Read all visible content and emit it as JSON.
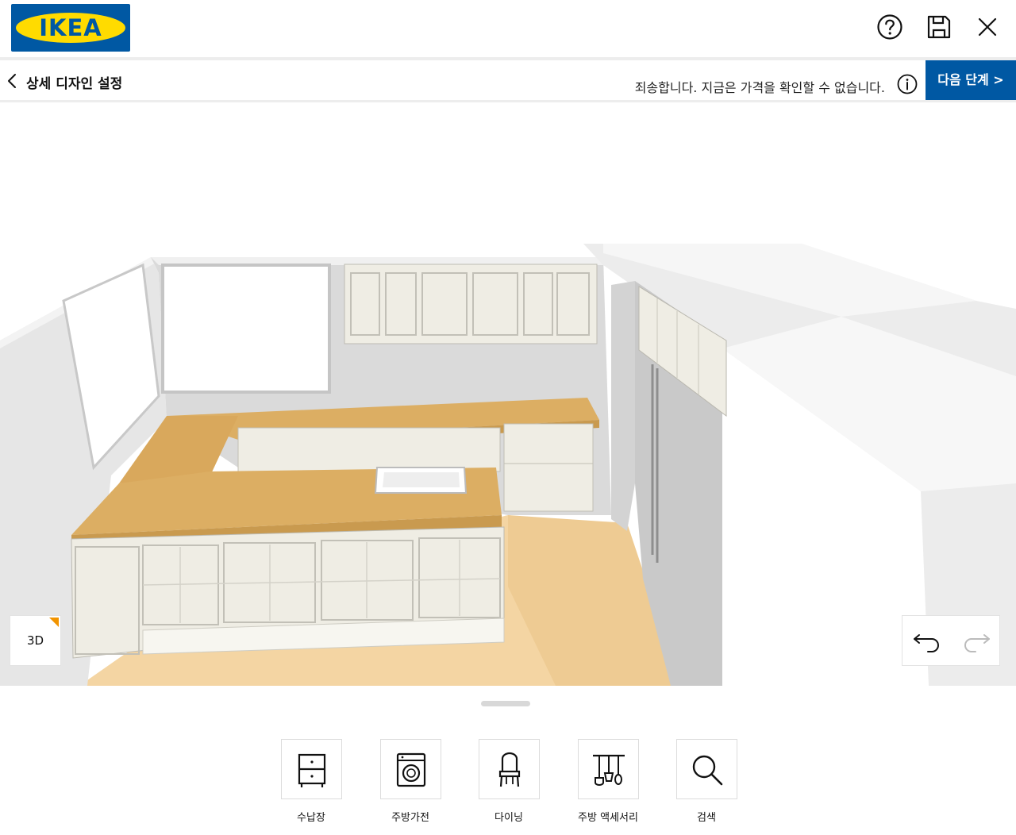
{
  "header": {
    "logo_text": "IKEA",
    "help_icon": "help-circle-icon",
    "save_icon": "save-floppy-icon",
    "close_icon": "close-icon"
  },
  "subheader": {
    "back_label": "상세 디자인 설정",
    "price_message": "죄송합니다. 지금은 가격을 확인할 수 없습니다.",
    "next_button_label": "다음 단계 >"
  },
  "canvas": {
    "view_mode_label": "3D",
    "undo_icon": "undo-arrow-icon",
    "redo_icon": "redo-arrow-icon"
  },
  "toolbar": {
    "items": [
      {
        "label": "수납장",
        "icon": "cabinet-icon"
      },
      {
        "label": "주방가전",
        "icon": "washing-machine-icon"
      },
      {
        "label": "다이닝",
        "icon": "chair-icon"
      },
      {
        "label": "주방 액세서리",
        "icon": "kitchen-utensils-icon"
      },
      {
        "label": "검색",
        "icon": "search-icon"
      }
    ]
  },
  "colors": {
    "brand_blue": "#0058a3",
    "brand_yellow": "#ffdb00",
    "accent_orange": "#f29400",
    "countertop": "#dcae63",
    "floor": "#f5d7a6",
    "cabinet": "#f1efe6"
  }
}
